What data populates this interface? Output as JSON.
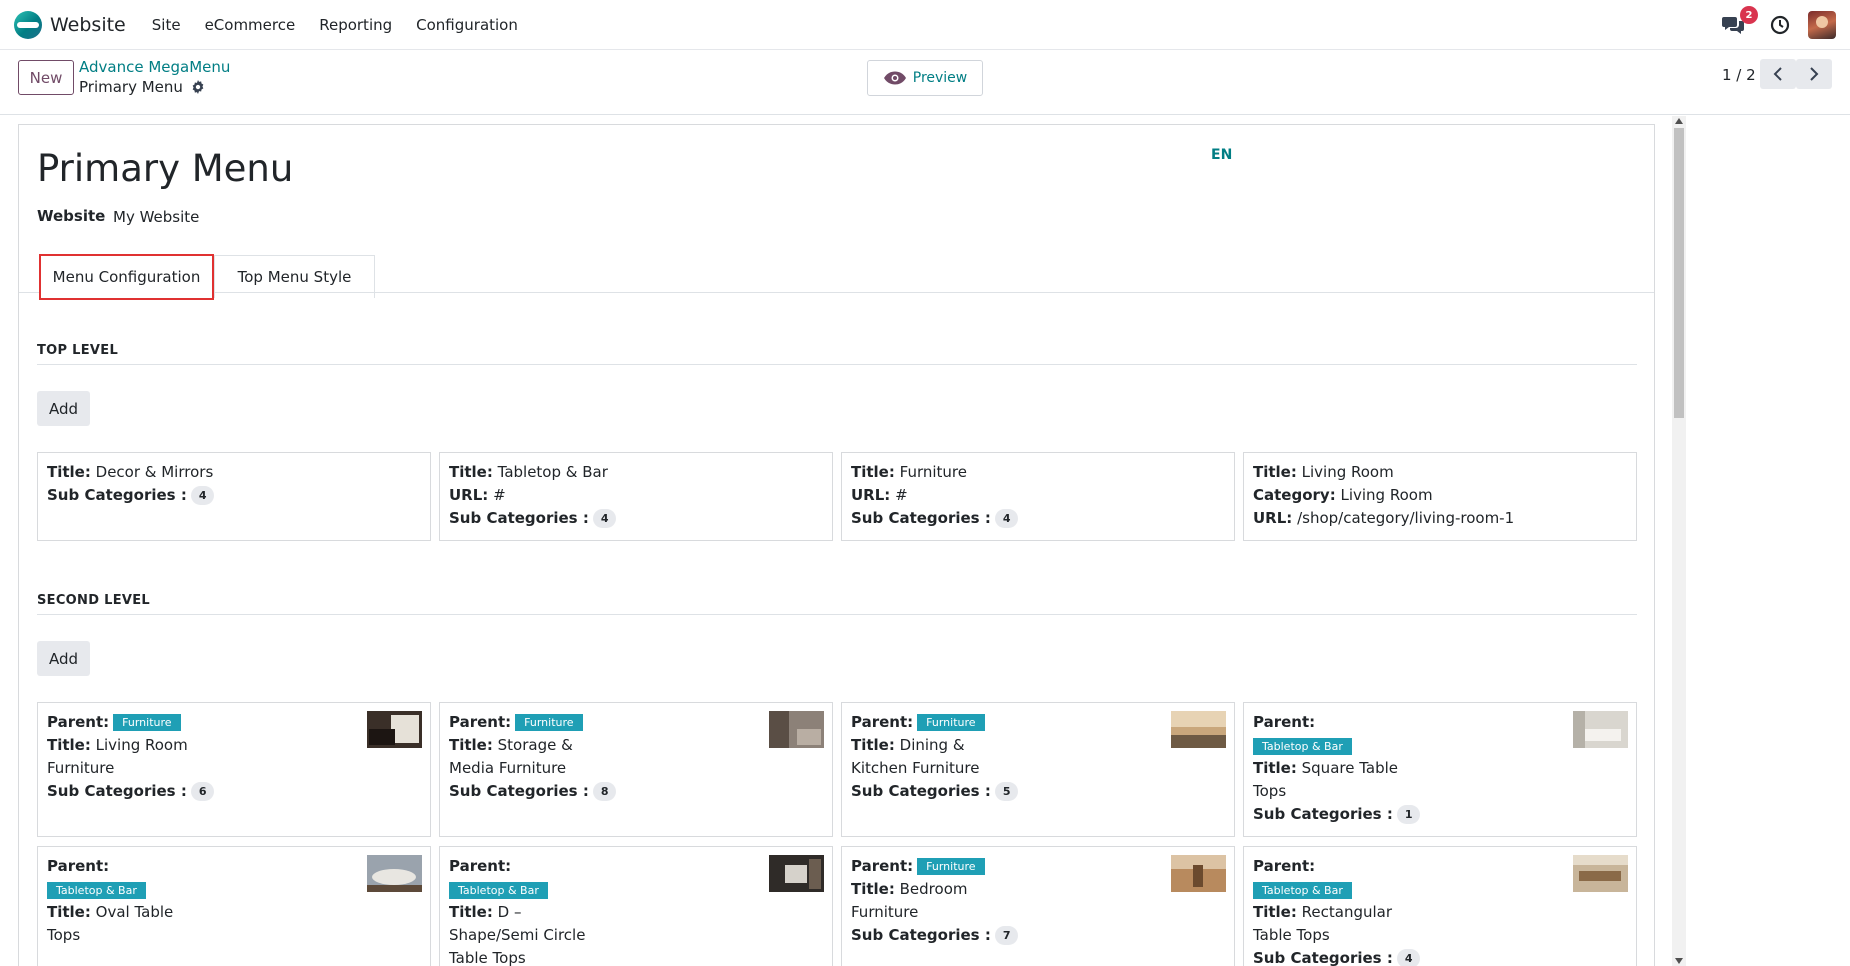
{
  "navbar": {
    "app_name": "Website",
    "menu": [
      "Site",
      "eCommerce",
      "Reporting",
      "Configuration"
    ],
    "chat_badge": "2"
  },
  "control": {
    "new_label": "New",
    "breadcrumb_parent": "Advance MegaMenu",
    "breadcrumb_current": "Primary Menu",
    "preview_label": "Preview",
    "pager": "1 / 2"
  },
  "form": {
    "title": "Primary Menu",
    "lang": "EN",
    "website_label": "Website",
    "website_value": "My Website",
    "tabs": [
      "Menu Configuration",
      "Top Menu Style"
    ]
  },
  "top_level": {
    "heading": "TOP LEVEL",
    "add_label": "Add",
    "cards": [
      {
        "title": "Decor & Mirrors",
        "subcats": "4"
      },
      {
        "title": "Tabletop & Bar",
        "url": "#",
        "subcats": "4"
      },
      {
        "title": "Furniture",
        "url": "#",
        "subcats": "4"
      },
      {
        "title": "Living Room",
        "category": "Living Room",
        "url": "/shop/category/living-room-1"
      }
    ]
  },
  "second_level": {
    "heading": "SECOND LEVEL",
    "add_label": "Add",
    "cards": [
      {
        "parent": "Furniture",
        "title_l1": "Living Room",
        "title_l2": "Furniture",
        "subcats": "6"
      },
      {
        "parent": "Furniture",
        "title_l1": "Storage &",
        "title_l2": "Media Furniture",
        "subcats": "8"
      },
      {
        "parent": "Furniture",
        "title_l1": "Dining &",
        "title_l2": "Kitchen Furniture",
        "subcats": "5"
      },
      {
        "parent": "Tabletop & Bar",
        "title_l1": "Square Table",
        "title_l2": "Tops",
        "subcats": "1"
      },
      {
        "parent": "Tabletop & Bar",
        "title_l1": "Oval Table",
        "title_l2": "Tops"
      },
      {
        "parent": "Tabletop & Bar",
        "title_l1": "D –",
        "title_l2": "Shape/Semi Circle",
        "title_l3": "Table Tops"
      },
      {
        "parent": "Furniture",
        "title_l1": "Bedroom",
        "title_l2": "Furniture",
        "subcats": "7"
      },
      {
        "parent": "Tabletop & Bar",
        "title_l1": "Rectangular",
        "title_l2": "Table Tops",
        "subcats": "4"
      }
    ]
  },
  "labels": {
    "title": "Title:",
    "url": "URL:",
    "category": "Category:",
    "subcats": "Sub Categories :",
    "parent": "Parent:"
  },
  "colors": {
    "brand_purple": "#714b67",
    "teal_link": "#017e84",
    "tag_teal": "#1f9fb5",
    "badge_red": "#d9344f",
    "highlight_red": "#e03131"
  }
}
